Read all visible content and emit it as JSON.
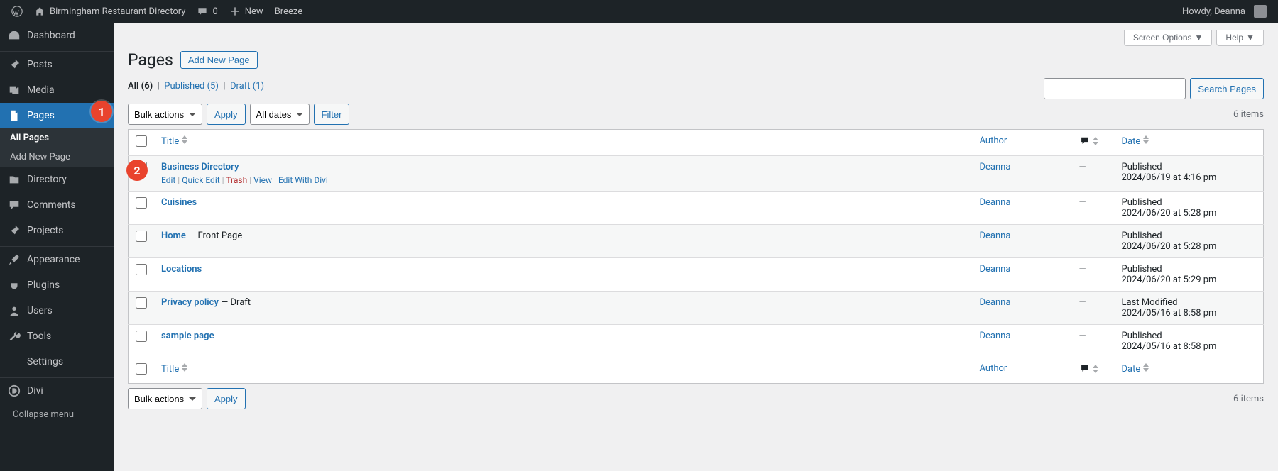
{
  "adminbar": {
    "site_name": "Birmingham Restaurant Directory",
    "comments_count": "0",
    "new_label": "New",
    "breeze_label": "Breeze",
    "howdy": "Howdy, Deanna"
  },
  "sidebar": {
    "items": [
      {
        "label": "Dashboard"
      },
      {
        "label": "Posts"
      },
      {
        "label": "Media"
      },
      {
        "label": "Pages"
      },
      {
        "label": "Directory"
      },
      {
        "label": "Comments"
      },
      {
        "label": "Projects"
      },
      {
        "label": "Appearance"
      },
      {
        "label": "Plugins"
      },
      {
        "label": "Users"
      },
      {
        "label": "Tools"
      },
      {
        "label": "Settings"
      },
      {
        "label": "Divi"
      }
    ],
    "submenu": {
      "all_pages": "All Pages",
      "add_new": "Add New Page"
    },
    "collapse": "Collapse menu"
  },
  "screen": {
    "options": "Screen Options",
    "help": "Help"
  },
  "header": {
    "title": "Pages",
    "add_new": "Add New Page"
  },
  "views": {
    "all_label": "All",
    "all_count": "(6)",
    "published_label": "Published",
    "published_count": "(5)",
    "draft_label": "Draft",
    "draft_count": "(1)"
  },
  "bulk": {
    "label": "Bulk actions",
    "apply": "Apply"
  },
  "dates": {
    "label": "All dates",
    "filter": "Filter"
  },
  "search": {
    "button": "Search Pages"
  },
  "count": {
    "label": "6 items"
  },
  "columns": {
    "title": "Title",
    "author": "Author",
    "date": "Date"
  },
  "row_actions": {
    "edit": "Edit",
    "quick_edit": "Quick Edit",
    "trash": "Trash",
    "view": "View",
    "edit_divi": "Edit With Divi"
  },
  "rows": [
    {
      "title": "Business Directory",
      "suffix": "",
      "author": "Deanna",
      "comments": "—",
      "status": "Published",
      "date": "2024/06/19 at 4:16 pm",
      "show_actions": true
    },
    {
      "title": "Cuisines",
      "suffix": "",
      "author": "Deanna",
      "comments": "—",
      "status": "Published",
      "date": "2024/06/20 at 5:28 pm"
    },
    {
      "title": "Home",
      "suffix": " — Front Page",
      "author": "Deanna",
      "comments": "—",
      "status": "Published",
      "date": "2024/06/20 at 5:28 pm"
    },
    {
      "title": "Locations",
      "suffix": "",
      "author": "Deanna",
      "comments": "—",
      "status": "Published",
      "date": "2024/06/20 at 5:29 pm"
    },
    {
      "title": "Privacy policy",
      "suffix": " — Draft",
      "author": "Deanna",
      "comments": "—",
      "status": "Last Modified",
      "date": "2024/05/16 at 8:58 pm"
    },
    {
      "title": "sample page",
      "suffix": "",
      "author": "Deanna",
      "comments": "—",
      "status": "Published",
      "date": "2024/05/16 at 8:58 pm"
    }
  ],
  "callouts": {
    "one": "1",
    "two": "2"
  }
}
